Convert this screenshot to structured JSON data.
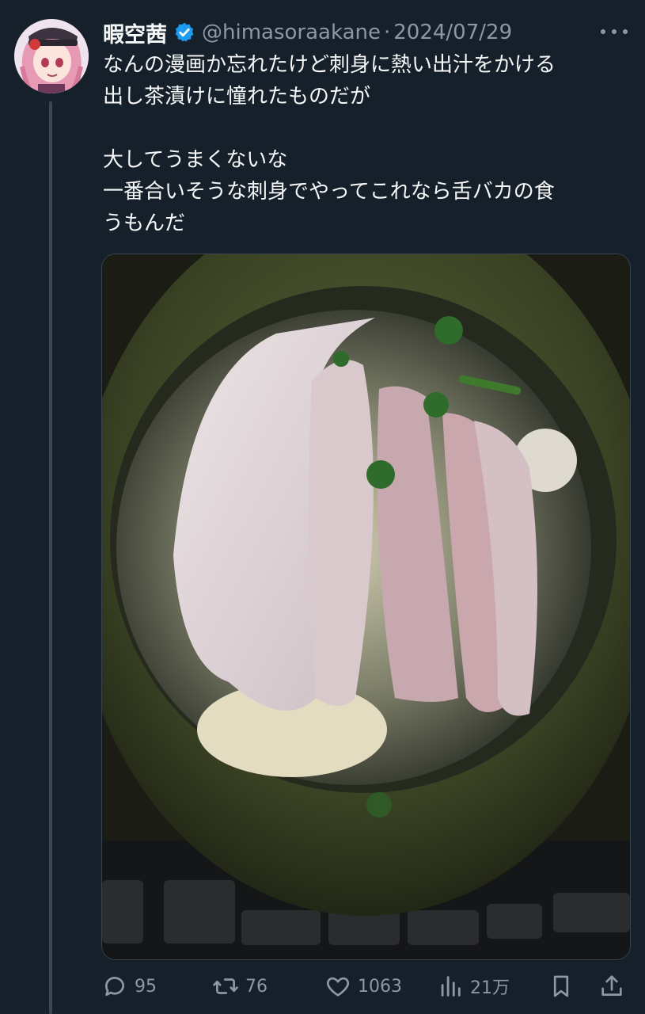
{
  "tweet": {
    "display_name": "暇空茜",
    "handle": "@himasoraakane",
    "separator": "·",
    "date": "2024/07/29",
    "lines": [
      "なんの漫画か忘れたけど刺身に熱い出汁をかける",
      "出し茶漬けに憧れたものだが",
      "",
      "大してうまくないな",
      "一番合いそうな刺身でやってこれなら舌バカの食",
      "うもんだ"
    ]
  },
  "actions": {
    "replies": "95",
    "retweets": "76",
    "likes": "1063",
    "views": "21万"
  },
  "icons": {
    "verified": "verified-badge-icon",
    "more": "more-dots-icon",
    "reply": "reply-icon",
    "retweet": "retweet-icon",
    "like": "heart-icon",
    "views": "views-icon",
    "bookmark": "bookmark-icon",
    "share": "share-icon"
  },
  "colors": {
    "background": "#15202b",
    "text": "#f7f9f9",
    "muted": "#8b98a5",
    "verified": "#1d9bf0"
  }
}
